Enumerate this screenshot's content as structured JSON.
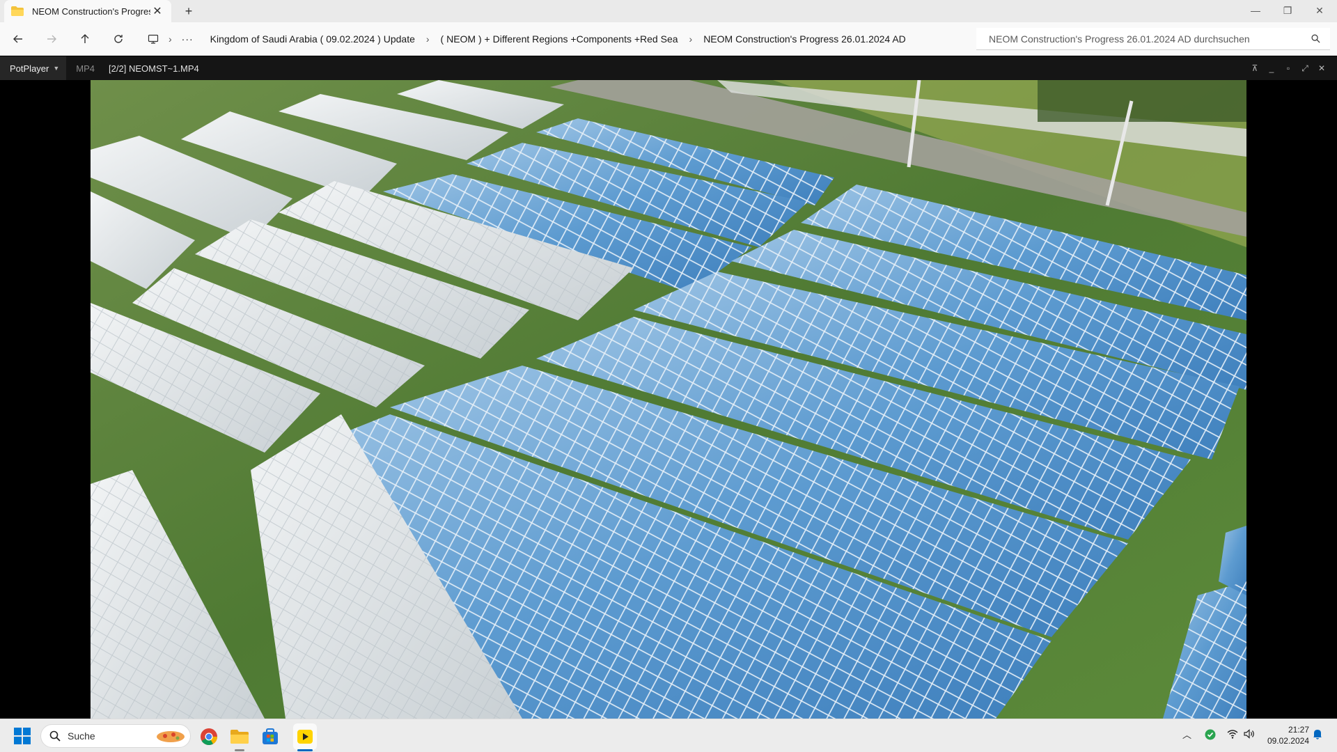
{
  "tab": {
    "title": "NEOM Construction's Progress",
    "icon": "folder-icon"
  },
  "window_controls": {
    "minimize": "minimize-icon",
    "restore": "restore-icon",
    "close": "close-icon"
  },
  "breadcrumb": {
    "items": [
      "Kingdom of Saudi Arabia ( 09.02.2024 ) Update",
      "( NEOM ) + Different Regions +Components +Red Sea",
      "NEOM Construction's Progress 26.01.2024 AD"
    ]
  },
  "search": {
    "placeholder": "NEOM Construction's Progress 26.01.2024 AD durchsuchen"
  },
  "player": {
    "brand": "PotPlayer",
    "format": "MP4",
    "file": "[2/2] NEOMST~1.MP4",
    "video_content": "aerial view of solar panel arrays on grass field"
  },
  "taskbar": {
    "search_label": "Suche",
    "apps": [
      "chrome-icon",
      "file-explorer-icon",
      "microsoft-store-icon",
      "potplayer-icon"
    ]
  },
  "clock": {
    "time": "21:27",
    "date": "09.02.2024"
  },
  "colors": {
    "accent": "#0067c0",
    "player_bg": "#000000",
    "panel_blue": "#4f8fc6",
    "grass": "#6f9a3f"
  }
}
